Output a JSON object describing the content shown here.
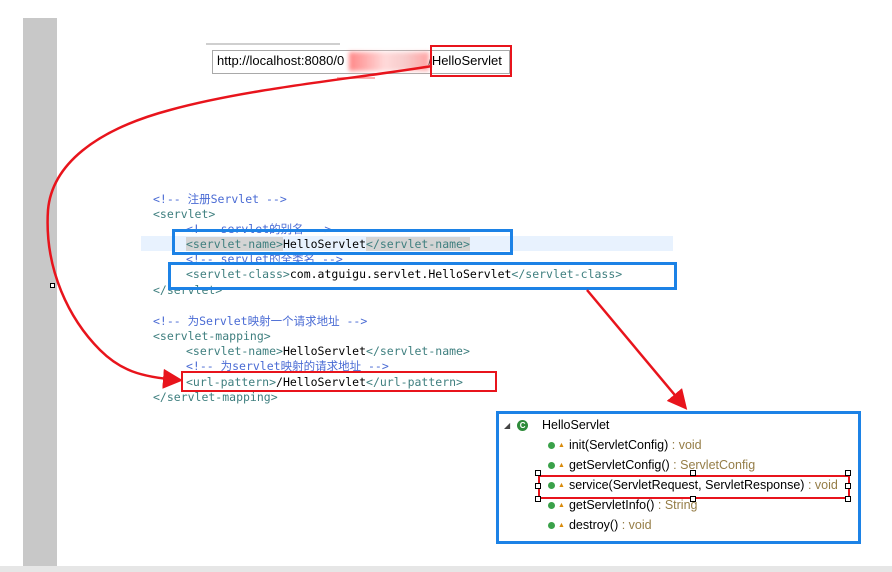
{
  "browser": {
    "url_text": "http://localhost:8080/0",
    "url_suffix": "/HelloServlet"
  },
  "web_xml": {
    "lines": [
      {
        "comment": "<!-- 注册Servlet -->"
      },
      {
        "open": "<servlet>"
      },
      {
        "comment": "<!-- servlet的别名 -->"
      },
      {
        "open": "<servlet-name>",
        "text": "HelloServlet",
        "close": "</servlet-name>"
      },
      {
        "comment": "<!-- servlet的全类名 -->"
      },
      {
        "open": "<servlet-class>",
        "text": "com.atguigu.servlet.HelloServlet",
        "close": "</servlet-class>"
      },
      {
        "close": "</servlet>"
      },
      {
        "comment": "<!-- 为Servlet映射一个请求地址 -->"
      },
      {
        "open": "<servlet-mapping>"
      },
      {
        "open": "<servlet-name>",
        "text": "HelloServlet",
        "close": "</servlet-name>"
      },
      {
        "comment": "<!-- 为servlet映射的请求地址 -->"
      },
      {
        "open": "<url-pattern>",
        "text": "/HelloServlet",
        "close": "</url-pattern>"
      },
      {
        "close": "</servlet-mapping>"
      }
    ]
  },
  "outline": {
    "class_name": "HelloServlet",
    "class_icon": "C",
    "methods": [
      {
        "sig": "init(ServletConfig)",
        "ret": " : void"
      },
      {
        "sig": "getServletConfig()",
        "ret": " : ServletConfig"
      },
      {
        "sig": "service(ServletRequest, ServletResponse)",
        "ret": " : void"
      },
      {
        "sig": "getServletInfo()",
        "ret": " : String"
      },
      {
        "sig": "destroy()",
        "ret": " : void"
      }
    ]
  },
  "colors": {
    "highlight_red": "#e8141c",
    "highlight_blue": "#1c82e6",
    "arrow_red": "#e8141c"
  }
}
